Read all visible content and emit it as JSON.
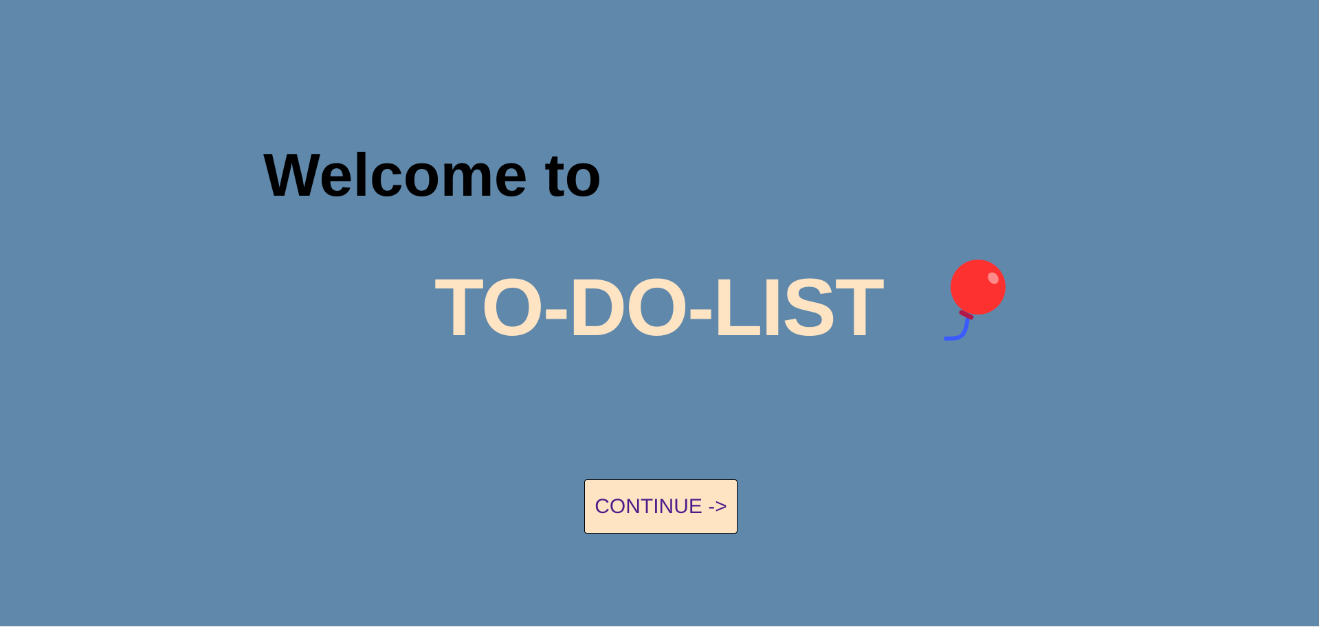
{
  "welcome": {
    "heading": "Welcome to",
    "title": "TO-DO-LIST"
  },
  "decoration": {
    "icon": "balloon-icon"
  },
  "actions": {
    "continue_label": "CONTINUE ->"
  },
  "colors": {
    "background": "#6088aa",
    "title": "#ffe4c4",
    "button_bg": "#ffe4c4",
    "button_text": "#4b1d8a",
    "balloon": "#fe3131",
    "string": "#3b5bff"
  }
}
